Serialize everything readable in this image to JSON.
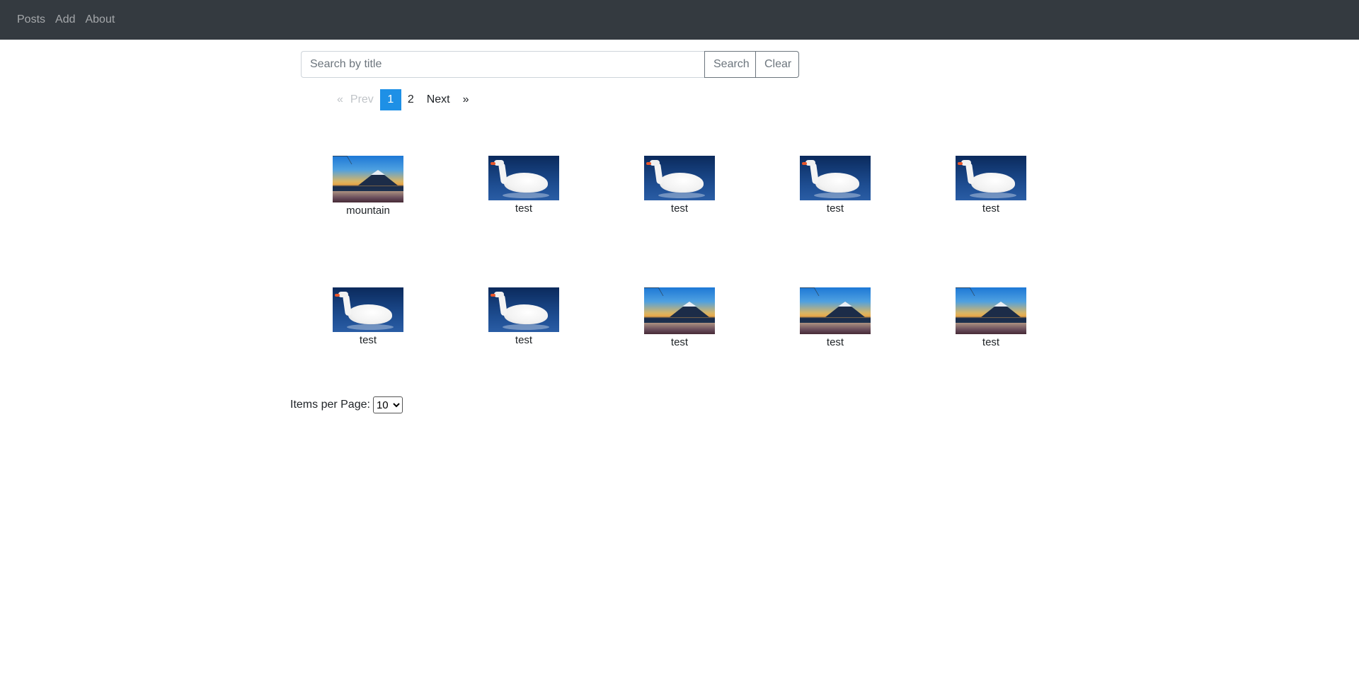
{
  "nav": {
    "links": [
      "Posts",
      "Add",
      "About"
    ]
  },
  "search": {
    "placeholder": "Search by title",
    "value": "",
    "search_label": "Search",
    "clear_label": "Clear"
  },
  "pagination": {
    "first": "«",
    "prev": "Prev",
    "pages": [
      "1",
      "2"
    ],
    "active_page": "1",
    "next": "Next",
    "last": "»"
  },
  "posts": [
    {
      "title": "mountain",
      "image": "mountain"
    },
    {
      "title": "test",
      "image": "swan"
    },
    {
      "title": "test",
      "image": "swan"
    },
    {
      "title": "test",
      "image": "swan"
    },
    {
      "title": "test",
      "image": "swan"
    },
    {
      "title": "test",
      "image": "swan"
    },
    {
      "title": "test",
      "image": "swan"
    },
    {
      "title": "test",
      "image": "mountain"
    },
    {
      "title": "test",
      "image": "mountain"
    },
    {
      "title": "test",
      "image": "mountain"
    }
  ],
  "items_per_page": {
    "label": "Items per Page:",
    "selected": "10",
    "options": [
      "10"
    ]
  },
  "colors": {
    "navbar_bg": "#343a40",
    "active_page": "#1e90e6"
  }
}
